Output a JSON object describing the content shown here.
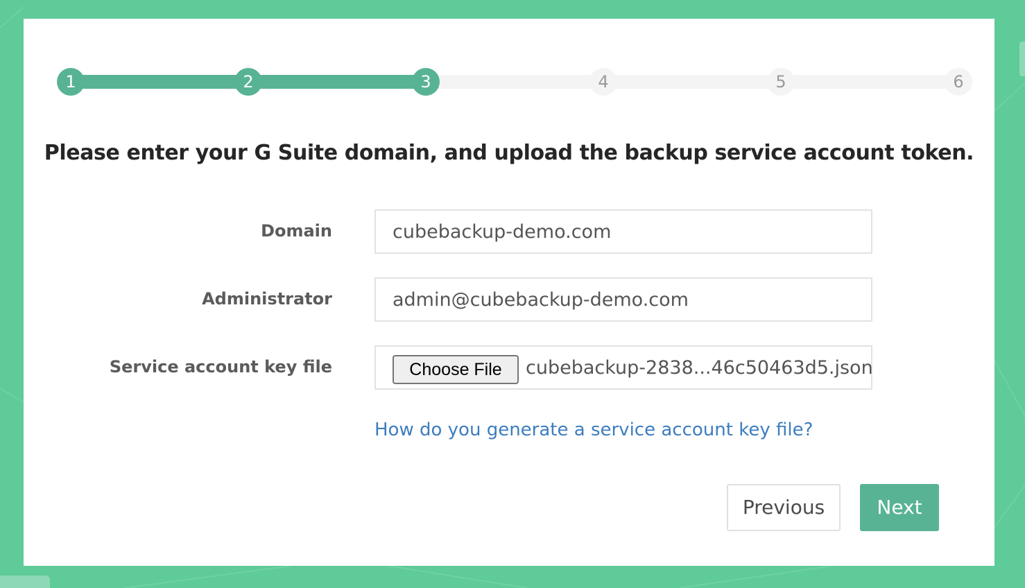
{
  "theme": {
    "accent": "#57b394",
    "background": "#5ecb98",
    "link": "#3d7dbf",
    "inactive_step": "#f4f4f4"
  },
  "stepper": {
    "current_step": 3,
    "steps": [
      {
        "label": "1",
        "state": "done"
      },
      {
        "label": "2",
        "state": "done"
      },
      {
        "label": "3",
        "state": "current"
      },
      {
        "label": "4",
        "state": "todo"
      },
      {
        "label": "5",
        "state": "todo"
      },
      {
        "label": "6",
        "state": "todo"
      }
    ]
  },
  "heading": "Please enter your G Suite domain, and upload the backup service account token.",
  "form": {
    "domain": {
      "label": "Domain",
      "value": "cubebackup-demo.com"
    },
    "administrator": {
      "label": "Administrator",
      "value": "admin@cubebackup-demo.com"
    },
    "key_file": {
      "label": "Service account key file",
      "button_label": "Choose File",
      "file_name": "cubebackup-2838...46c50463d5.json"
    },
    "help_link": "How do you generate a service account key file?"
  },
  "buttons": {
    "previous": "Previous",
    "next": "Next"
  }
}
